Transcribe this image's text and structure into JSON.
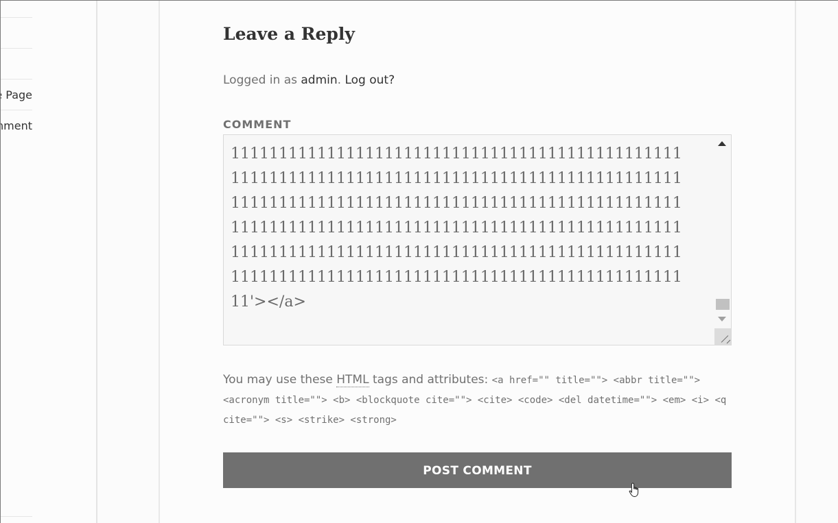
{
  "sidebar": {
    "links": [
      {
        "label": "Sample Page"
      },
      {
        "label": "Hello world! comment"
      }
    ]
  },
  "reply": {
    "title": "Leave a Reply",
    "logged_prefix": "Logged in as ",
    "user_link": "admin",
    "logout_link": "Log out?"
  },
  "comment": {
    "label": "COMMENT",
    "value": "11111111111111111111111111111111111111111111111\n11111111111111111111111111111111111111111111111\n11111111111111111111111111111111111111111111111\n11111111111111111111111111111111111111111111111\n11111111111111111111111111111111111111111111111\n11111111111111111111111111111111111111111111111\n11'></a>"
  },
  "allowed_tags": {
    "prefix": "You may use these ",
    "abbr": "HTML",
    "middle": " tags and attributes: ",
    "tags": "<a href=\"\" title=\"\"> <abbr title=\"\"> <acronym title=\"\"> <b> <blockquote cite=\"\"> <cite> <code> <del datetime=\"\"> <em> <i> <q cite=\"\"> <s> <strike> <strong>"
  },
  "submit": {
    "label": "POST COMMENT"
  },
  "colors": {
    "button_bg": "#707070",
    "text_muted": "#707070",
    "text_dark": "#333333"
  }
}
